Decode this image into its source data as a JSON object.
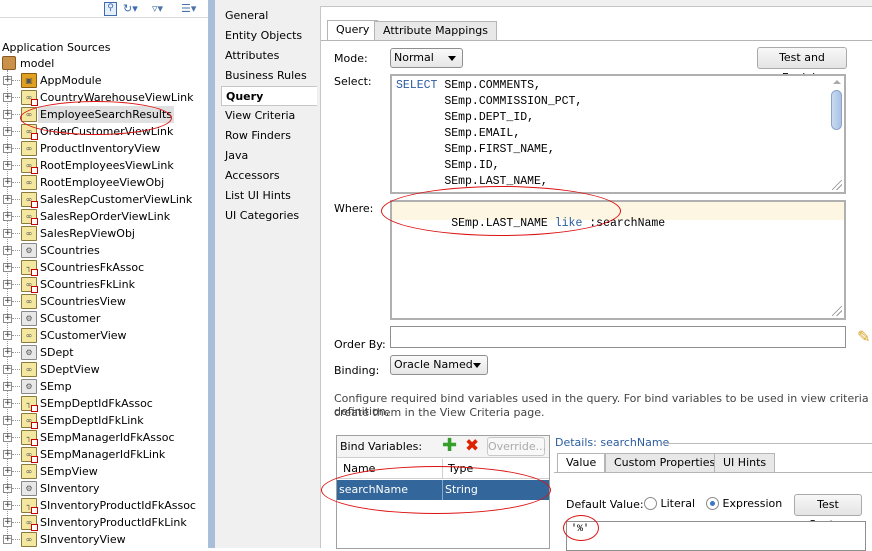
{
  "left_panel": {
    "toolbar_icons": [
      "search-icon",
      "refresh-icon",
      "filter-icon",
      "layout-icon"
    ],
    "section_title": "Application Sources",
    "root_node": "model",
    "items": [
      {
        "label": "AppModule",
        "icon": "app-module-icon",
        "kind": "module"
      },
      {
        "label": "CountryWarehouseViewLink",
        "icon": "view-link-icon",
        "kind": "link"
      },
      {
        "label": "EmployeeSearchResults",
        "icon": "view-object-icon",
        "kind": "view",
        "selected": true
      },
      {
        "label": "OrderCustomerViewLink",
        "icon": "view-link-icon",
        "kind": "link"
      },
      {
        "label": "ProductInventoryView",
        "icon": "view-object-icon",
        "kind": "view"
      },
      {
        "label": "RootEmployeesViewLink",
        "icon": "view-link-icon",
        "kind": "link"
      },
      {
        "label": "RootEmployeeViewObj",
        "icon": "view-object-icon",
        "kind": "view"
      },
      {
        "label": "SalesRepCustomerViewLink",
        "icon": "view-link-icon",
        "kind": "link"
      },
      {
        "label": "SalesRepOrderViewLink",
        "icon": "view-link-icon",
        "kind": "link"
      },
      {
        "label": "SalesRepViewObj",
        "icon": "view-object-icon",
        "kind": "view"
      },
      {
        "label": "SCountries",
        "icon": "entity-object-icon",
        "kind": "entity"
      },
      {
        "label": "SCountriesFkAssoc",
        "icon": "association-icon",
        "kind": "assoc"
      },
      {
        "label": "SCountriesFkLink",
        "icon": "view-link-icon",
        "kind": "link"
      },
      {
        "label": "SCountriesView",
        "icon": "view-object-icon",
        "kind": "view"
      },
      {
        "label": "SCustomer",
        "icon": "entity-object-icon",
        "kind": "entity"
      },
      {
        "label": "SCustomerView",
        "icon": "view-object-icon",
        "kind": "view"
      },
      {
        "label": "SDept",
        "icon": "entity-object-icon",
        "kind": "entity"
      },
      {
        "label": "SDeptView",
        "icon": "view-object-icon",
        "kind": "view"
      },
      {
        "label": "SEmp",
        "icon": "entity-object-icon",
        "kind": "entity"
      },
      {
        "label": "SEmpDeptIdFkAssoc",
        "icon": "association-icon",
        "kind": "assoc"
      },
      {
        "label": "SEmpDeptIdFkLink",
        "icon": "view-link-icon",
        "kind": "link"
      },
      {
        "label": "SEmpManagerIdFkAssoc",
        "icon": "association-icon",
        "kind": "assoc"
      },
      {
        "label": "SEmpManagerIdFkLink",
        "icon": "view-link-icon",
        "kind": "link"
      },
      {
        "label": "SEmpView",
        "icon": "view-object-icon",
        "kind": "view"
      },
      {
        "label": "SInventory",
        "icon": "entity-object-icon",
        "kind": "entity"
      },
      {
        "label": "SInventoryProductIdFkAssoc",
        "icon": "association-icon",
        "kind": "assoc"
      },
      {
        "label": "SInventoryProductIdFkLink",
        "icon": "view-link-icon",
        "kind": "link"
      },
      {
        "label": "SInventoryView",
        "icon": "view-object-icon",
        "kind": "view"
      }
    ]
  },
  "nav": {
    "items": [
      "General",
      "Entity Objects",
      "Attributes",
      "Business Rules",
      "Query",
      "View Criteria",
      "Row Finders",
      "Java",
      "Accessors",
      "List UI Hints",
      "UI Categories"
    ],
    "active": "Query"
  },
  "main": {
    "tabs": [
      "Query",
      "Attribute Mappings"
    ],
    "active_tab": "Query",
    "mode_label": "Mode:",
    "mode_value": "Normal",
    "test_explain_label": "Test and Explain",
    "select_label": "Select:",
    "select_keyword": "SELECT",
    "select_lines": [
      "SEmp.COMMENTS,",
      "SEmp.COMMISSION_PCT,",
      "SEmp.DEPT_ID,",
      "SEmp.EMAIL,",
      "SEmp.FIRST_NAME,",
      "SEmp.ID,",
      "SEmp.LAST_NAME,"
    ],
    "where_label": "Where:",
    "where_prefix": "SEmp.LAST_NAME",
    "where_keyword": "like",
    "where_suffix": ":searchName",
    "order_by_label": "Order By:",
    "order_by_value": "",
    "binding_label": "Binding:",
    "binding_value": "Oracle Named",
    "help_text_1": "Configure required bind variables used in the query.  For bind variables to be used in view criteria definition,",
    "help_text_2": "create them in the View Criteria page.",
    "bind_vars": {
      "title": "Bind Variables:",
      "override_label": "Override...",
      "columns": [
        "Name",
        "Type"
      ],
      "rows": [
        {
          "name": "searchName",
          "type": "String"
        }
      ]
    },
    "details": {
      "title": "Details: searchName",
      "tabs": [
        "Value",
        "Custom Properties",
        "UI Hints"
      ],
      "active_tab": "Value",
      "default_value_label": "Default Value:",
      "radio_literal": "Literal",
      "radio_expression": "Expression",
      "selected_radio": "Expression",
      "test_syntax_label": "Test Syntax",
      "expression_value": "'%'"
    }
  },
  "colors": {
    "keyword": "#2c5c9e",
    "selection": "#33669a",
    "annotation": "#dd1111",
    "where_highlight": "#fdf6e3"
  }
}
